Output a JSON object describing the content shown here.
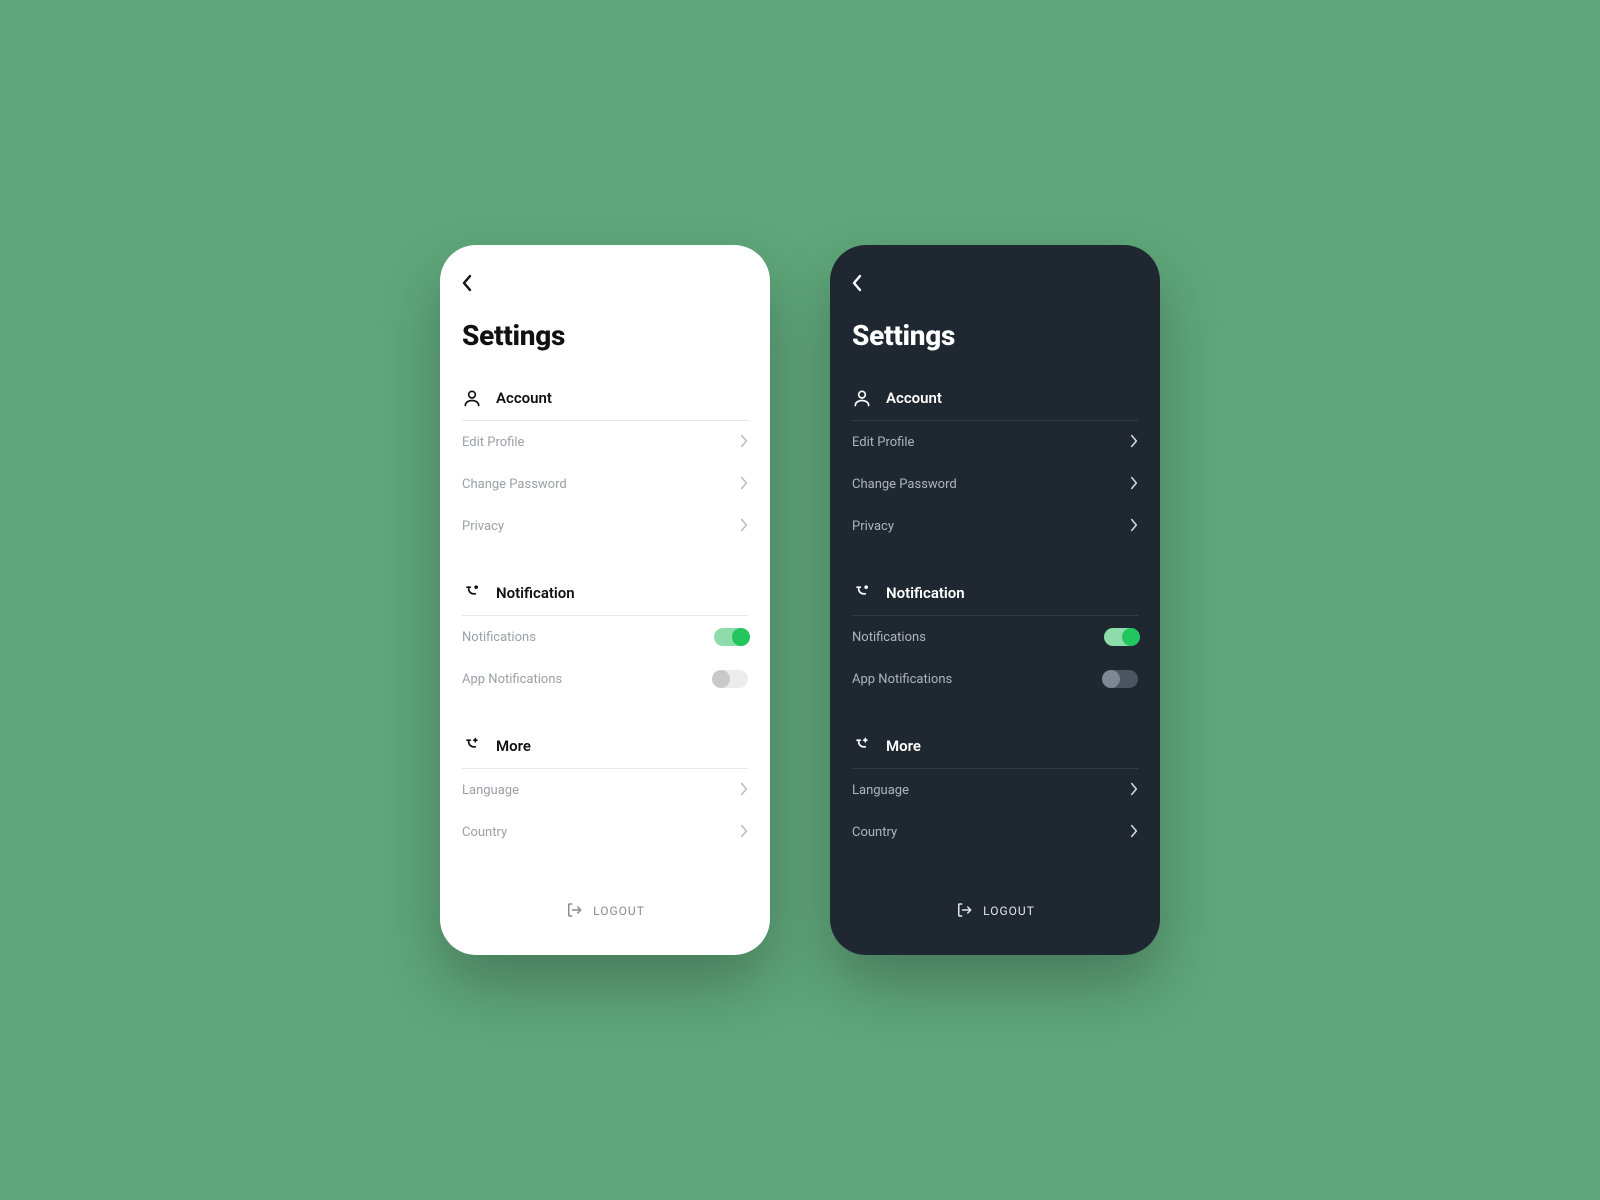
{
  "page_title": "Settings",
  "sections": {
    "account": {
      "title": "Account",
      "items": [
        {
          "label": "Edit Profile"
        },
        {
          "label": "Change Password"
        },
        {
          "label": "Privacy"
        }
      ]
    },
    "notification": {
      "title": "Notification",
      "items": [
        {
          "label": "Notifications",
          "toggle": true
        },
        {
          "label": "App Notifications",
          "toggle": false
        }
      ]
    },
    "more": {
      "title": "More",
      "items": [
        {
          "label": "Language"
        },
        {
          "label": "Country"
        }
      ]
    }
  },
  "logout_label": "LOGOUT",
  "colors": {
    "background": "#5fa67a",
    "accent": "#22c55e",
    "light_card": "#ffffff",
    "dark_card": "#1f2731"
  }
}
